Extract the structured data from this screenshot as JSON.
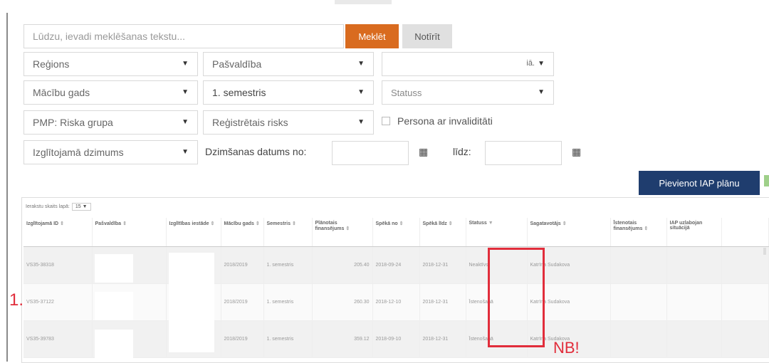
{
  "search": {
    "placeholder": "Lūdzu, ievadi meklēšanas tekstu...",
    "search_button": "Meklēt",
    "clear_button": "Notīrīt"
  },
  "filters": {
    "region": "Reģions",
    "municipality": "Pašvaldība",
    "school_partial": "iā.",
    "school_year": "Mācību gads",
    "semester": "1. semestris",
    "status": "Statuss",
    "risk_group": "PMP: Riska grupa",
    "registered_risk": "Reģistrētais risks",
    "disability_label": "Persona ar invaliditāti",
    "gender": "Izglītojamā dzimums",
    "dob_from_label": "Dzimšanas datums no:",
    "dob_to_label": "līdz:"
  },
  "icons": {
    "dropdown": "caret-down-icon",
    "calendar": "calendar-icon"
  },
  "actions": {
    "add_plan": "Pievienot IAP plānu"
  },
  "table": {
    "per_page_label": "Ierakstu skaits lapā:",
    "per_page_value": "15",
    "columns": [
      "Izglītojamā ID",
      "Pašvaldība",
      "Izglītības iestāde",
      "Mācību gads",
      "Semestris",
      "Plānotais finansējums",
      "Spēkā no",
      "Spēkā līdz",
      "Statuss",
      "Sagatavotājs",
      "Īstenotais finansējums",
      "IAP uzlabojan situācijā"
    ],
    "rows": [
      {
        "id": "VS35-38318",
        "year": "2018/2019",
        "semester": "1. semestris",
        "planned": "205.40",
        "from": "2018-09-24",
        "to": "2018-12-31",
        "status": "Neaktīvs",
        "author": "Katrīna Sudakova"
      },
      {
        "id": "VS35-37122",
        "year": "2018/2019",
        "semester": "1. semestris",
        "planned": "260.30",
        "from": "2018-12-10",
        "to": "2018-12-31",
        "status": "Īstenošanā",
        "author": "Katrīna Sudakova"
      },
      {
        "id": "VS35-39783",
        "year": "2018/2019",
        "semester": "1. semestris",
        "planned": "359.12",
        "from": "2018-09-10",
        "to": "2018-12-31",
        "status": "Īstenošanā",
        "author": "Katrīna Sudakova"
      }
    ]
  },
  "annotations": {
    "row_marker": "1.",
    "note": "NB!",
    "color": "#e12d3b"
  },
  "colors": {
    "search_button": "#d96b1f",
    "add_button": "#1f3d6e"
  }
}
